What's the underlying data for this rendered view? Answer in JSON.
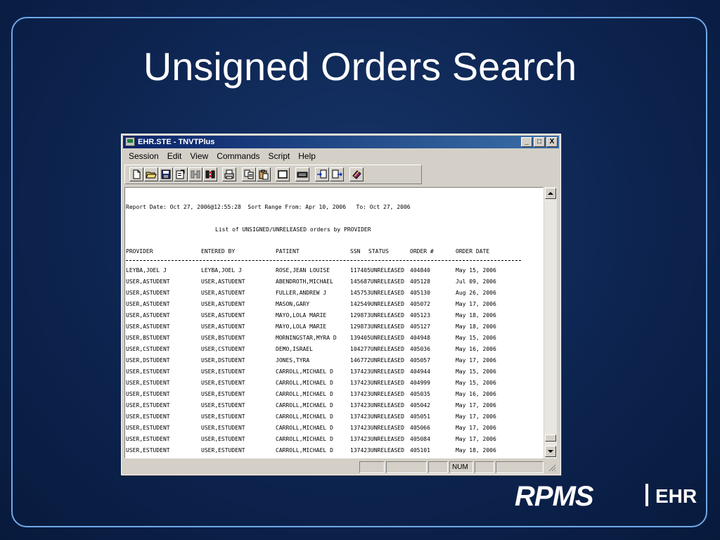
{
  "slide": {
    "title": "Unsigned Orders Search",
    "logo_text": "RPMS",
    "logo_suffix": "EHR"
  },
  "window": {
    "title": "EHR.STE - TNVTPlus",
    "controls": [
      "_",
      "□",
      "X"
    ]
  },
  "menu": [
    "Session",
    "Edit",
    "View",
    "Commands",
    "Script",
    "Help"
  ],
  "toolbar_icons": [
    "new-document-icon",
    "open-folder-icon",
    "save-icon",
    "properties-icon",
    "disconnect-icon",
    "connect-icon",
    "print-icon",
    "copy-icon",
    "paste-icon",
    "blank-screen-icon",
    "keyboard-icon",
    "send-file-icon",
    "receive-file-icon",
    "help-book-icon"
  ],
  "report": {
    "header_line": "Report Date: Oct 27, 2006@12:55:28  Sort Range From: Apr 10, 2006   To: Oct 27, 2006",
    "subtitle": "List of UNSIGNED/UNRELEASED orders by PROVIDER",
    "columns": [
      "PROVIDER",
      "ENTERED BY",
      "PATIENT",
      "SSN",
      "STATUS",
      "ORDER #",
      "ORDER DATE"
    ],
    "rows": [
      [
        "LEYBA,JOEL J",
        "LEYBA,JOEL J",
        "ROSE,JEAN LOUISE",
        "117405UNRELEASED",
        "404840",
        "May 15, 2006"
      ],
      [
        "USER,ASTUDENT",
        "USER,ASTUDENT",
        "ABENDROTH,MICHAEL",
        "145687UNRELEASED",
        "405128",
        "Jul 09, 2006"
      ],
      [
        "USER,ASTUDENT",
        "USER,ASTUDENT",
        "FULLER,ANDREW J",
        "145753UNRELEASED",
        "405130",
        "Aug 26, 2006"
      ],
      [
        "USER,ASTUDENT",
        "USER,ASTUDENT",
        "MASON,GARY",
        "142549UNRELEASED",
        "405072",
        "May 17, 2006"
      ],
      [
        "USER,ASTUDENT",
        "USER,ASTUDENT",
        "MAYO,LOLA MARIE",
        "129873UNRELEASED",
        "405123",
        "May 18, 2006"
      ],
      [
        "USER,ASTUDENT",
        "USER,ASTUDENT",
        "MAYO,LOLA MARIE",
        "129873UNRELEASED",
        "405127",
        "May 18, 2006"
      ],
      [
        "USER,BSTUDENT",
        "USER,BSTUDENT",
        "MORNINGSTAR,MYRA D",
        "139405UNRELEASED",
        "404948",
        "May 15, 2006"
      ],
      [
        "USER,CSTUDENT",
        "USER,CSTUDENT",
        "DEMO,ISRAEL",
        "104277UNRELEASED",
        "405036",
        "May 16, 2006"
      ],
      [
        "USER,DSTUDENT",
        "USER,DSTUDENT",
        "JONES,TYRA",
        "146772UNRELEASED",
        "405057",
        "May 17, 2006"
      ],
      [
        "USER,ESTUDENT",
        "USER,ESTUDENT",
        "CARROLL,MICHAEL D",
        "137423UNRELEASED",
        "404944",
        "May 15, 2006"
      ],
      [
        "USER,ESTUDENT",
        "USER,ESTUDENT",
        "CARROLL,MICHAEL D",
        "137423UNRELEASED",
        "404999",
        "May 15, 2006"
      ],
      [
        "USER,ESTUDENT",
        "USER,ESTUDENT",
        "CARROLL,MICHAEL D",
        "137423UNRELEASED",
        "405035",
        "May 16, 2006"
      ],
      [
        "USER,ESTUDENT",
        "USER,ESTUDENT",
        "CARROLL,MICHAEL D",
        "137423UNRELEASED",
        "405042",
        "May 17, 2006"
      ],
      [
        "USER,ESTUDENT",
        "USER,ESTUDENT",
        "CARROLL,MICHAEL D",
        "137423UNRELEASED",
        "405051",
        "May 17, 2006"
      ],
      [
        "USER,ESTUDENT",
        "USER,ESTUDENT",
        "CARROLL,MICHAEL D",
        "137423UNRELEASED",
        "405066",
        "May 17, 2006"
      ],
      [
        "USER,ESTUDENT",
        "USER,ESTUDENT",
        "CARROLL,MICHAEL D",
        "137423UNRELEASED",
        "405084",
        "May 17, 2006"
      ],
      [
        "USER,ESTUDENT",
        "USER,ESTUDENT",
        "CARROLL,MICHAEL D",
        "137423UNRELEASED",
        "405101",
        "May 18, 2006"
      ]
    ]
  },
  "statusbar": {
    "num_label": "NUM"
  }
}
